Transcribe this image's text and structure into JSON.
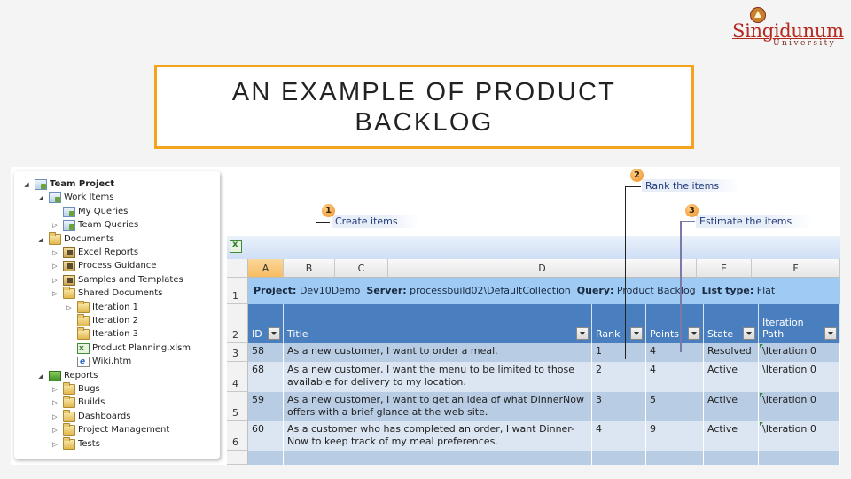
{
  "logo": {
    "name": "Singidunum",
    "subtitle": "University"
  },
  "slide_title": "AN EXAMPLE OF PRODUCT BACKLOG",
  "tree": [
    {
      "label": "Team Project",
      "icon": "team-project-icon",
      "expander": "expanded",
      "bold": true
    },
    {
      "label": "Work Items",
      "icon": "work-items-icon",
      "expander": "expanded"
    },
    {
      "label": "My Queries",
      "icon": "my-queries-icon",
      "expander": "none"
    },
    {
      "label": "Team Queries",
      "icon": "team-queries-icon",
      "expander": "collapsed"
    },
    {
      "label": "Documents",
      "icon": "folder-open-icon",
      "expander": "expanded"
    },
    {
      "label": "Excel Reports",
      "icon": "document-folder-icon",
      "expander": "collapsed"
    },
    {
      "label": "Process Guidance",
      "icon": "document-folder-icon",
      "expander": "collapsed"
    },
    {
      "label": "Samples and Templates",
      "icon": "document-folder-icon",
      "expander": "collapsed"
    },
    {
      "label": "Shared Documents",
      "icon": "folder-open-icon",
      "expander": "collapsed"
    },
    {
      "label": "Iteration 1",
      "icon": "folder-icon",
      "expander": "collapsed"
    },
    {
      "label": "Iteration 2",
      "icon": "folder-icon",
      "expander": "none"
    },
    {
      "label": "Iteration 3",
      "icon": "folder-icon",
      "expander": "none"
    },
    {
      "label": "Product Planning.xlsm",
      "icon": "excel-file-icon",
      "expander": "none"
    },
    {
      "label": "Wiki.htm",
      "icon": "html-file-icon",
      "expander": "none"
    },
    {
      "label": "Reports",
      "icon": "reports-icon",
      "expander": "expanded"
    },
    {
      "label": "Bugs",
      "icon": "folder-icon",
      "expander": "collapsed"
    },
    {
      "label": "Builds",
      "icon": "folder-icon",
      "expander": "collapsed"
    },
    {
      "label": "Dashboards",
      "icon": "folder-icon",
      "expander": "collapsed"
    },
    {
      "label": "Project Management",
      "icon": "folder-icon",
      "expander": "collapsed"
    },
    {
      "label": "Tests",
      "icon": "folder-icon",
      "expander": "collapsed"
    }
  ],
  "callouts": [
    {
      "number": "1",
      "text": "Create items"
    },
    {
      "number": "2",
      "text": "Rank the items"
    },
    {
      "number": "3",
      "text": "Estimate the items"
    }
  ],
  "sheet": {
    "column_letters": [
      "A",
      "B",
      "C",
      "D",
      "E",
      "F"
    ],
    "selected_column": "A",
    "row_numbers": [
      "1",
      "2",
      "3",
      "4",
      "5",
      "6"
    ],
    "info": {
      "project_label": "Project:",
      "project": "Dev10Demo",
      "server_label": "Server:",
      "server": "processbuild02\\DefaultCollection",
      "query_label": "Query:",
      "query": "Product Backlog",
      "listtype_label": "List type:",
      "listtype": "Flat"
    },
    "headers": [
      "ID",
      "Title",
      "Rank",
      "Points",
      "State",
      "Iteration Path"
    ],
    "rows": [
      {
        "id": "58",
        "title": "As a new customer, I want to order a meal.",
        "rank": "1",
        "points": "4",
        "state": "Resolved",
        "iteration": "\\Iteration 0"
      },
      {
        "id": "68",
        "title": "As a new customer, I want the menu to be limited to those available for delivery to my location.",
        "rank": "2",
        "points": "4",
        "state": "Active",
        "iteration": "\\Iteration 0"
      },
      {
        "id": "59",
        "title": "As a new customer, I want to get an idea of what DinnerNow offers with a brief glance at the web site.",
        "rank": "3",
        "points": "5",
        "state": "Active",
        "iteration": "\\Iteration 0"
      },
      {
        "id": "60",
        "title": "As a customer who has completed an order, I want Dinner-Now to keep track of my meal preferences.",
        "rank": "4",
        "points": "9",
        "state": "Active",
        "iteration": "\\Iteration 0"
      }
    ]
  }
}
